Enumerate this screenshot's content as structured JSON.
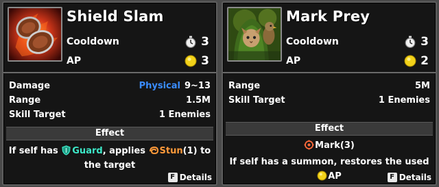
{
  "cards": [
    {
      "name": "Shield Slam",
      "cooldown_label": "Cooldown",
      "cooldown_value": "3",
      "ap_label": "AP",
      "ap_value": "3",
      "damage_label": "Damage",
      "damage_type": "Physical",
      "damage_value": "9~13",
      "range_label": "Range",
      "range_value": "1.5M",
      "target_label": "Skill Target",
      "target_value": "1 Enemies",
      "effect_header": "Effect",
      "effect_pre": "If self has ",
      "effect_guard": "Guard",
      "effect_mid": ", applies ",
      "effect_stun": "Stun",
      "effect_stun_count": "(1)",
      "effect_post": " to the target",
      "details_key": "F",
      "details_label": "Details"
    },
    {
      "name": "Mark Prey",
      "cooldown_label": "Cooldown",
      "cooldown_value": "3",
      "ap_label": "AP",
      "ap_value": "2",
      "range_label": "Range",
      "range_value": "5M",
      "target_label": "Skill Target",
      "target_value": "1 Enemies",
      "effect_header": "Effect",
      "effect_mark": "Mark(3)",
      "effect_summon": "If self has a summon, restores the used ",
      "effect_summon_ap": "AP",
      "details_key": "F",
      "details_label": "Details"
    }
  ],
  "colors": {
    "physical": "#3a8cff",
    "guard": "#3de8c8",
    "stun": "#ff9a3a",
    "ap_coin": "#f2d21a"
  },
  "icons": [
    "stopwatch-icon",
    "ap-coin-icon",
    "guard-shield-icon",
    "stun-icon",
    "mark-icon",
    "f-key-icon"
  ]
}
